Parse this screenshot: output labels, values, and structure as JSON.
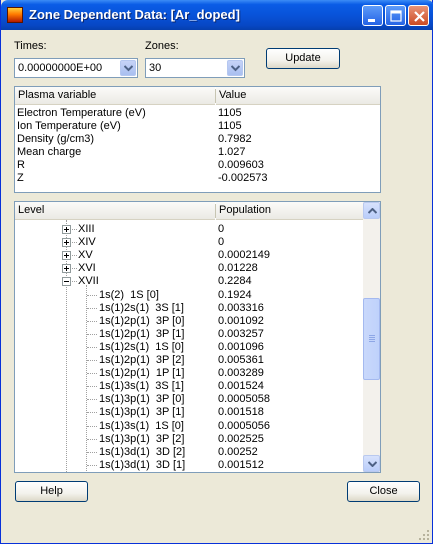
{
  "window": {
    "title": "Zone Dependent Data: [Ar_doped]"
  },
  "controls": {
    "times_label": "Times:",
    "times_value": "0.00000000E+00",
    "zones_label": "Zones:",
    "zones_value": "30",
    "update_label": "Update"
  },
  "plasma": {
    "headers": [
      "Plasma variable",
      "Value"
    ],
    "rows": [
      [
        "Electron Temperature (eV)",
        "1105"
      ],
      [
        "Ion Temperature (eV)",
        "1105"
      ],
      [
        "Density (g/cm3)",
        "0.7982"
      ],
      [
        "Mean charge",
        "1.027"
      ],
      [
        "R",
        "0.009603"
      ],
      [
        "Z",
        "-0.002573"
      ]
    ]
  },
  "levels": {
    "headers": [
      "Level",
      "Population"
    ],
    "rows": [
      {
        "label": "XIII",
        "value": "0",
        "type": "collapsed"
      },
      {
        "label": "XIV",
        "value": "0",
        "type": "collapsed"
      },
      {
        "label": "XV",
        "value": "0.0002149",
        "type": "collapsed"
      },
      {
        "label": "XVI",
        "value": "0.01228",
        "type": "collapsed"
      },
      {
        "label": "XVII",
        "value": "0.2284",
        "type": "expanded"
      },
      {
        "label": "1s(2)  1S [0]",
        "value": "0.1924",
        "type": "child"
      },
      {
        "label": "1s(1)2s(1)  3S [1]",
        "value": "0.003316",
        "type": "child"
      },
      {
        "label": "1s(1)2p(1)  3P [0]",
        "value": "0.001092",
        "type": "child"
      },
      {
        "label": "1s(1)2p(1)  3P [1]",
        "value": "0.003257",
        "type": "child"
      },
      {
        "label": "1s(1)2s(1)  1S [0]",
        "value": "0.001096",
        "type": "child"
      },
      {
        "label": "1s(1)2p(1)  3P [2]",
        "value": "0.005361",
        "type": "child"
      },
      {
        "label": "1s(1)2p(1)  1P [1]",
        "value": "0.003289",
        "type": "child"
      },
      {
        "label": "1s(1)3s(1)  3S [1]",
        "value": "0.001524",
        "type": "child"
      },
      {
        "label": "1s(1)3p(1)  3P [0]",
        "value": "0.0005058",
        "type": "child"
      },
      {
        "label": "1s(1)3p(1)  3P [1]",
        "value": "0.001518",
        "type": "child"
      },
      {
        "label": "1s(1)3s(1)  1S [0]",
        "value": "0.0005056",
        "type": "child"
      },
      {
        "label": "1s(1)3p(1)  3P [2]",
        "value": "0.002525",
        "type": "child"
      },
      {
        "label": "1s(1)3d(1)  3D [2]",
        "value": "0.00252",
        "type": "child"
      },
      {
        "label": "1s(1)3d(1)  3D [1]",
        "value": "0.001512",
        "type": "child"
      }
    ]
  },
  "footer": {
    "help_label": "Help",
    "close_label": "Close"
  },
  "icons": {
    "app": "app-icon",
    "minimize": "minimize-icon",
    "maximize": "maximize-icon",
    "close": "close-icon",
    "dropdown": "chevron-down-icon",
    "expand": "plus-box-icon",
    "collapse": "minus-box-icon"
  }
}
